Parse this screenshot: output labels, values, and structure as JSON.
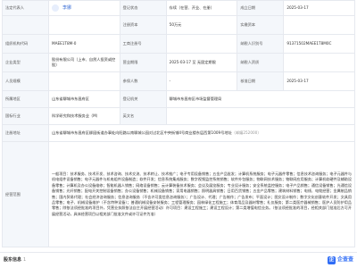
{
  "rows": {
    "legal": {
      "label": "法定代表人",
      "name": "李娜",
      "label2": "登记状态",
      "value2": "存续（在营、开业、在册）",
      "label3": "成立日期",
      "value3": "2025-03-17"
    },
    "capital": {
      "label": "",
      "value": "",
      "label2": "注册资本",
      "value2": "50万元",
      "label3": "实缴资本",
      "value3": ""
    },
    "org": {
      "label": "组织机构代码",
      "value": "MAEE1T8M-0",
      "label2": "工商注册号",
      "value2": "",
      "label3": "纳税人识别号",
      "value3": "91371502MAEE1T8M0C"
    },
    "type": {
      "label": "企业类型",
      "value": "股份有限公司（上市、自然人投资或控股）",
      "label2": "营业期限",
      "value2": "2025-03-17 至 无固定期限",
      "label3": "纳税人资质",
      "value3": ""
    },
    "staff": {
      "label": "人员规模",
      "value": "",
      "label2": "参保人数",
      "value2": "-",
      "label3": "核准日期",
      "value3": "2025-03-17"
    },
    "region": {
      "label": "所属地区",
      "value": "山东省聊城市东昌府区",
      "label2": "登记机关",
      "value2": "聊城市东昌府区市场监督管理局"
    },
    "industry": {
      "label": "国标行业",
      "value": "科学研究和技术服务业（M）",
      "label2": "英文名",
      "value2": ""
    },
    "address": {
      "label": "注册地址",
      "value": "山东省聊城市东昌府区柳园街道办事处向阳路以南聊城公园对过北区中央街铺4号商业楼东层西第1009号地址",
      "hint": "（邮编252000）"
    },
    "scope": {
      "label": "经营范围",
      "text": "一般项目：技术服务、技术开发、技术咨询、技术交流、技术转让、技术推广；电子专用设备销售；五金产品批发；计算机系统服务；电子元器件零售；信息技术咨询服务；电子元器件与机电组件设备销售；电子元器件与机电组件设备制造；软件开发；信息系统集成服务；数字视频监控系统销售；软件外包服务；物联网技术服务；物联网应用服务；计算机软硬件及辅助设备零售；计算机及办公设备维修；智能机器人销售；网络设备销售；云计算装备技术服务；会议及展览服务；专业设计服务；安全系统监控服务；电子产品销售；通信设备销售；光通信设备销售；光纤销售；配电开关控制设备销售；办公设备销售；机械设备销售；家用电器销售；照明器具销售；日用百货销售；五金产品零售；建筑材料销售；电线、电缆经营；金属制品销售；国内贸易代理；社会经济咨询服务；信息咨询服务（不含许可类信息咨询服务）；广告设计、代理；广告制作；广告发布；平面设计；图文设计制作；数字文化创意软件开发；文具用品零售；电子、机械设备维护（不含特种设备）；普通机械设备安装服务；工程管理服务；园林绿化工程施工；体育用品及器材零售；礼仪服务；第二类医疗器械销售；医护人员防护用品零售；除依法须经批准的项目外，凭营业执照依法自主开展经营活动）许可项目：建设工程施工；建设工程设计；第二类增值电信业务。（依法须经批准的项目，经相关部门批准后方可开展经营活动，具体经营项目以相关部门批准文件或许可证件为准）"
    }
  },
  "footer": {
    "title": "股东信息",
    "count": "1",
    "brand": "企查查",
    "brand_mark": "企"
  }
}
